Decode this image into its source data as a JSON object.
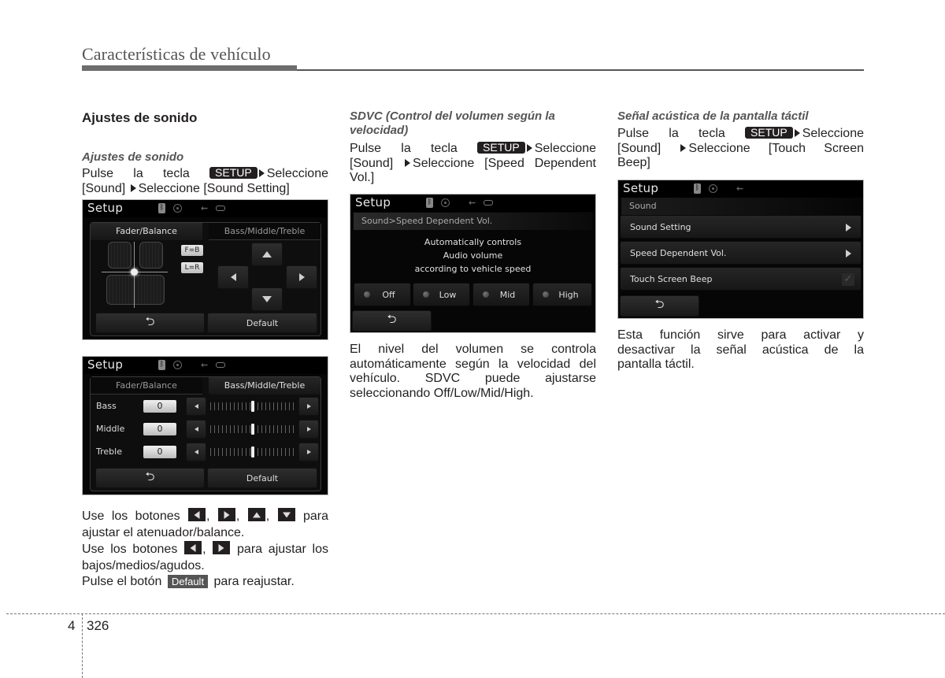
{
  "header": {
    "title": "Características de vehículo"
  },
  "column1": {
    "section_title": "Ajustes de sonido",
    "subtitle": "Ajustes de sonido",
    "instruction": {
      "line1_pre": "Pulse la tecla",
      "key": "SETUP",
      "line1_post": "Seleccione",
      "line2_a": "[Sound]",
      "line2_b": "Seleccione [Sound Setting]"
    },
    "screen1": {
      "title": "Setup",
      "tabs": [
        "Fader/Balance",
        "Bass/Middle/Treble"
      ],
      "active_tab": "Fader/Balance",
      "chips": [
        "F=B",
        "L=R"
      ],
      "arrows": [
        "up-icon",
        "left-icon",
        "right-icon",
        "down-icon"
      ],
      "back_icon": "⮌",
      "default_label": "Default"
    },
    "screen2": {
      "title": "Setup",
      "tabs": [
        "Fader/Balance",
        "Bass/Middle/Treble"
      ],
      "active_tab": "Bass/Middle/Treble",
      "rows": [
        {
          "label": "Bass",
          "value": "0",
          "level": 0.5
        },
        {
          "label": "Middle",
          "value": "0",
          "level": 0.5
        },
        {
          "label": "Treble",
          "value": "0",
          "level": 0.5
        }
      ],
      "back_icon": "⮌",
      "default_label": "Default"
    },
    "notes": {
      "line1_pre": "Use los botones",
      "line1_post": "para",
      "line2": "ajustar el atenuador/balance.",
      "line3_pre": "Use los botones",
      "line3_post": "para ajustar los",
      "line4": "bajos/medios/agudos.",
      "line5_pre": "Pulse el botón",
      "default_chip": "Default",
      "line5_post": "para reajustar.",
      "sep": ","
    }
  },
  "column2": {
    "subtitle_line1": "SDVC (Control del volumen según la",
    "subtitle_line2": "velocidad)",
    "instruction": {
      "line1_pre": "Pulse la tecla",
      "key": "SETUP",
      "line1_post": "Seleccione",
      "line2_a": "[Sound]",
      "line2_b": "Seleccione [Speed Dependent",
      "line3": "Vol.]"
    },
    "screen": {
      "title": "Setup",
      "breadcrumb": "Sound>Speed Dependent Vol.",
      "description": [
        "Automatically controls",
        "Audio volume",
        "according to vehicle speed"
      ],
      "options": [
        "Off",
        "Low",
        "Mid",
        "High"
      ],
      "back_icon": "⮌"
    },
    "body": {
      "line1": "El nivel del volumen se controla",
      "line2": "automáticamente según la velocidad del",
      "line3": "vehículo. SDVC puede ajustarse",
      "line4": "seleccionando Off/Low/Mid/High."
    }
  },
  "column3": {
    "subtitle": "Señal acústica de la pantalla táctil",
    "instruction": {
      "line1_pre": "Pulse la tecla",
      "key": "SETUP",
      "line1_post": "Seleccione",
      "line2_a": "[Sound]",
      "line2_b": "Seleccione [Touch Screen",
      "line3": "Beep]"
    },
    "screen": {
      "title": "Setup",
      "section": "Sound",
      "items": [
        {
          "label": "Sound Setting",
          "type": "submenu"
        },
        {
          "label": "Speed Dependent Vol.",
          "type": "submenu"
        },
        {
          "label": "Touch Screen Beep",
          "type": "checkbox",
          "checked": true
        }
      ],
      "back_icon": "⮌"
    },
    "body": {
      "line1": "Esta función sirve para activar y",
      "line2": "desactivar la señal acústica de la",
      "line3": "pantalla táctil."
    }
  },
  "footer": {
    "chapter": "4",
    "page": "326"
  }
}
